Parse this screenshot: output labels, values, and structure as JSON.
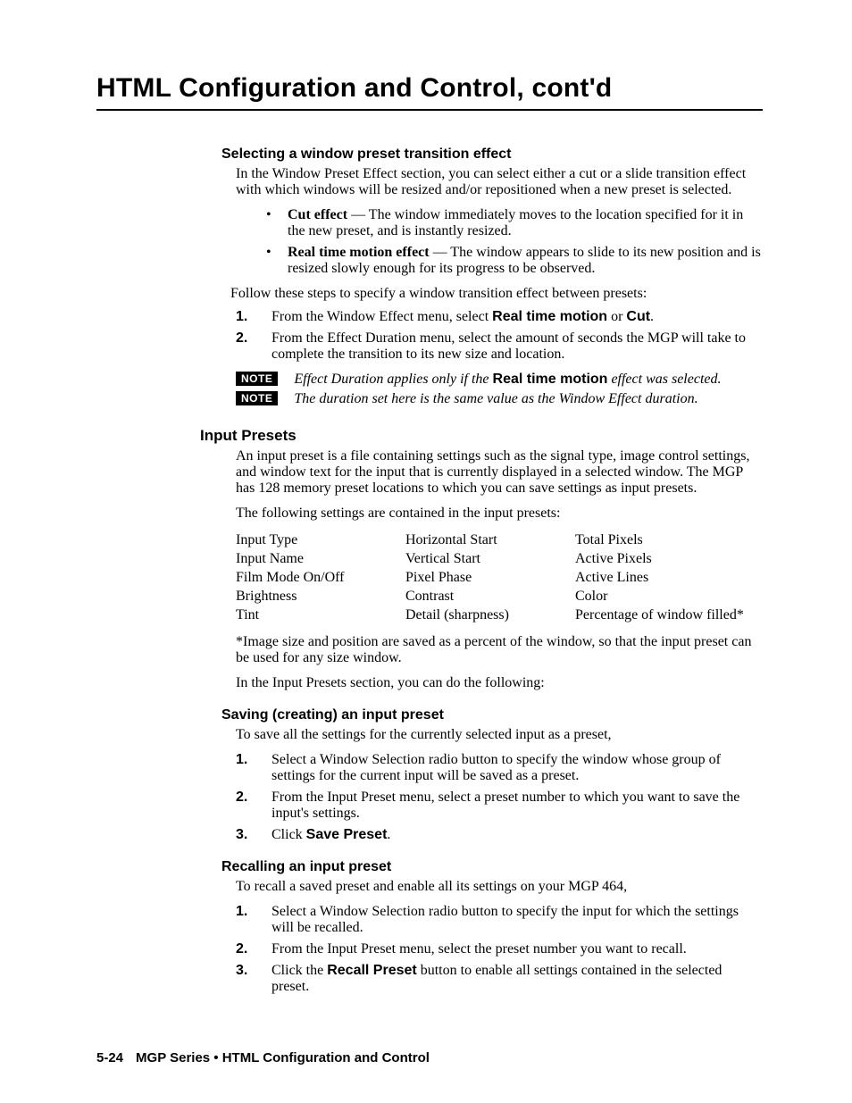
{
  "header": "HTML Configuration and Control, cont'd",
  "s1": {
    "title": "Selecting a window preset transition effect",
    "intro": "In the Window Preset Effect section, you can select either a cut or a slide transition effect with which windows will be resized and/or repositioned when a new preset is selected.",
    "bullet1_lead": "Cut effect",
    "bullet1_rest": " — The window immediately moves to the location specified for it in the new preset, and is instantly resized.",
    "bullet2_lead": "Real time motion effect",
    "bullet2_rest": " — The window appears to slide to its new position and is resized slowly enough for its progress to be observed.",
    "follow": "Follow these steps to specify a window transition effect between presets:",
    "step1a": "From the Window Effect menu, select ",
    "step1b": "Real time motion",
    "step1c": " or ",
    "step1d": "Cut",
    "step1e": ".",
    "step2": "From the Effect Duration menu, select the amount of seconds the MGP will take to complete the transition to its new size and location.",
    "note_label": "NOTE",
    "note1a": "Effect Duration applies only if the ",
    "note1b": "Real time motion",
    "note1c": " effect was selected.",
    "note2": "The duration set here is the same value as the Window Effect duration."
  },
  "s2": {
    "title": "Input Presets",
    "p1": "An input preset is a file containing settings such as the signal type, image control settings, and window text for the input that is currently displayed in a selected window.  The MGP has 128 memory preset locations to which you can save settings as input presets.",
    "p2": "The following settings are contained in the input presets:",
    "col1": [
      "Input Type",
      "Input Name",
      "Film Mode On/Off",
      "Brightness",
      "Tint"
    ],
    "col2": [
      "Horizontal Start",
      "Vertical Start",
      "Pixel Phase",
      "Contrast",
      "Detail (sharpness)"
    ],
    "col3": [
      "Total Pixels",
      "Active Pixels",
      "Active Lines",
      "Color",
      "Percentage of window filled*"
    ],
    "note": "*Image size and position are saved as a percent of the window, so that the input preset can be used for any size window.",
    "p3": "In the Input Presets section, you can do the following:"
  },
  "s3": {
    "title": "Saving (creating) an input preset",
    "intro": "To save all the settings for the currently selected input as a preset,",
    "step1": "Select a Window Selection radio button to specify the window whose group of settings for the current input will be saved as a preset.",
    "step2": "From the Input Preset menu, select a preset number to which you want to save the input's settings.",
    "step3a": "Click ",
    "step3b": "Save Preset",
    "step3c": "."
  },
  "s4": {
    "title": "Recalling an input preset",
    "intro": "To recall a saved preset and enable all its settings on your MGP 464,",
    "step1": "Select a Window Selection radio button to specify the input for which the settings will be recalled.",
    "step2": "From the Input Preset menu, select the preset number you want to recall.",
    "step3a": "Click the ",
    "step3b": "Recall Preset",
    "step3c": " button to enable all settings contained in the selected preset."
  },
  "nums": {
    "n1": "1.",
    "n2": "2.",
    "n3": "3."
  },
  "footer": {
    "page": "5-24",
    "text": "MGP Series • HTML Configuration and Control"
  }
}
